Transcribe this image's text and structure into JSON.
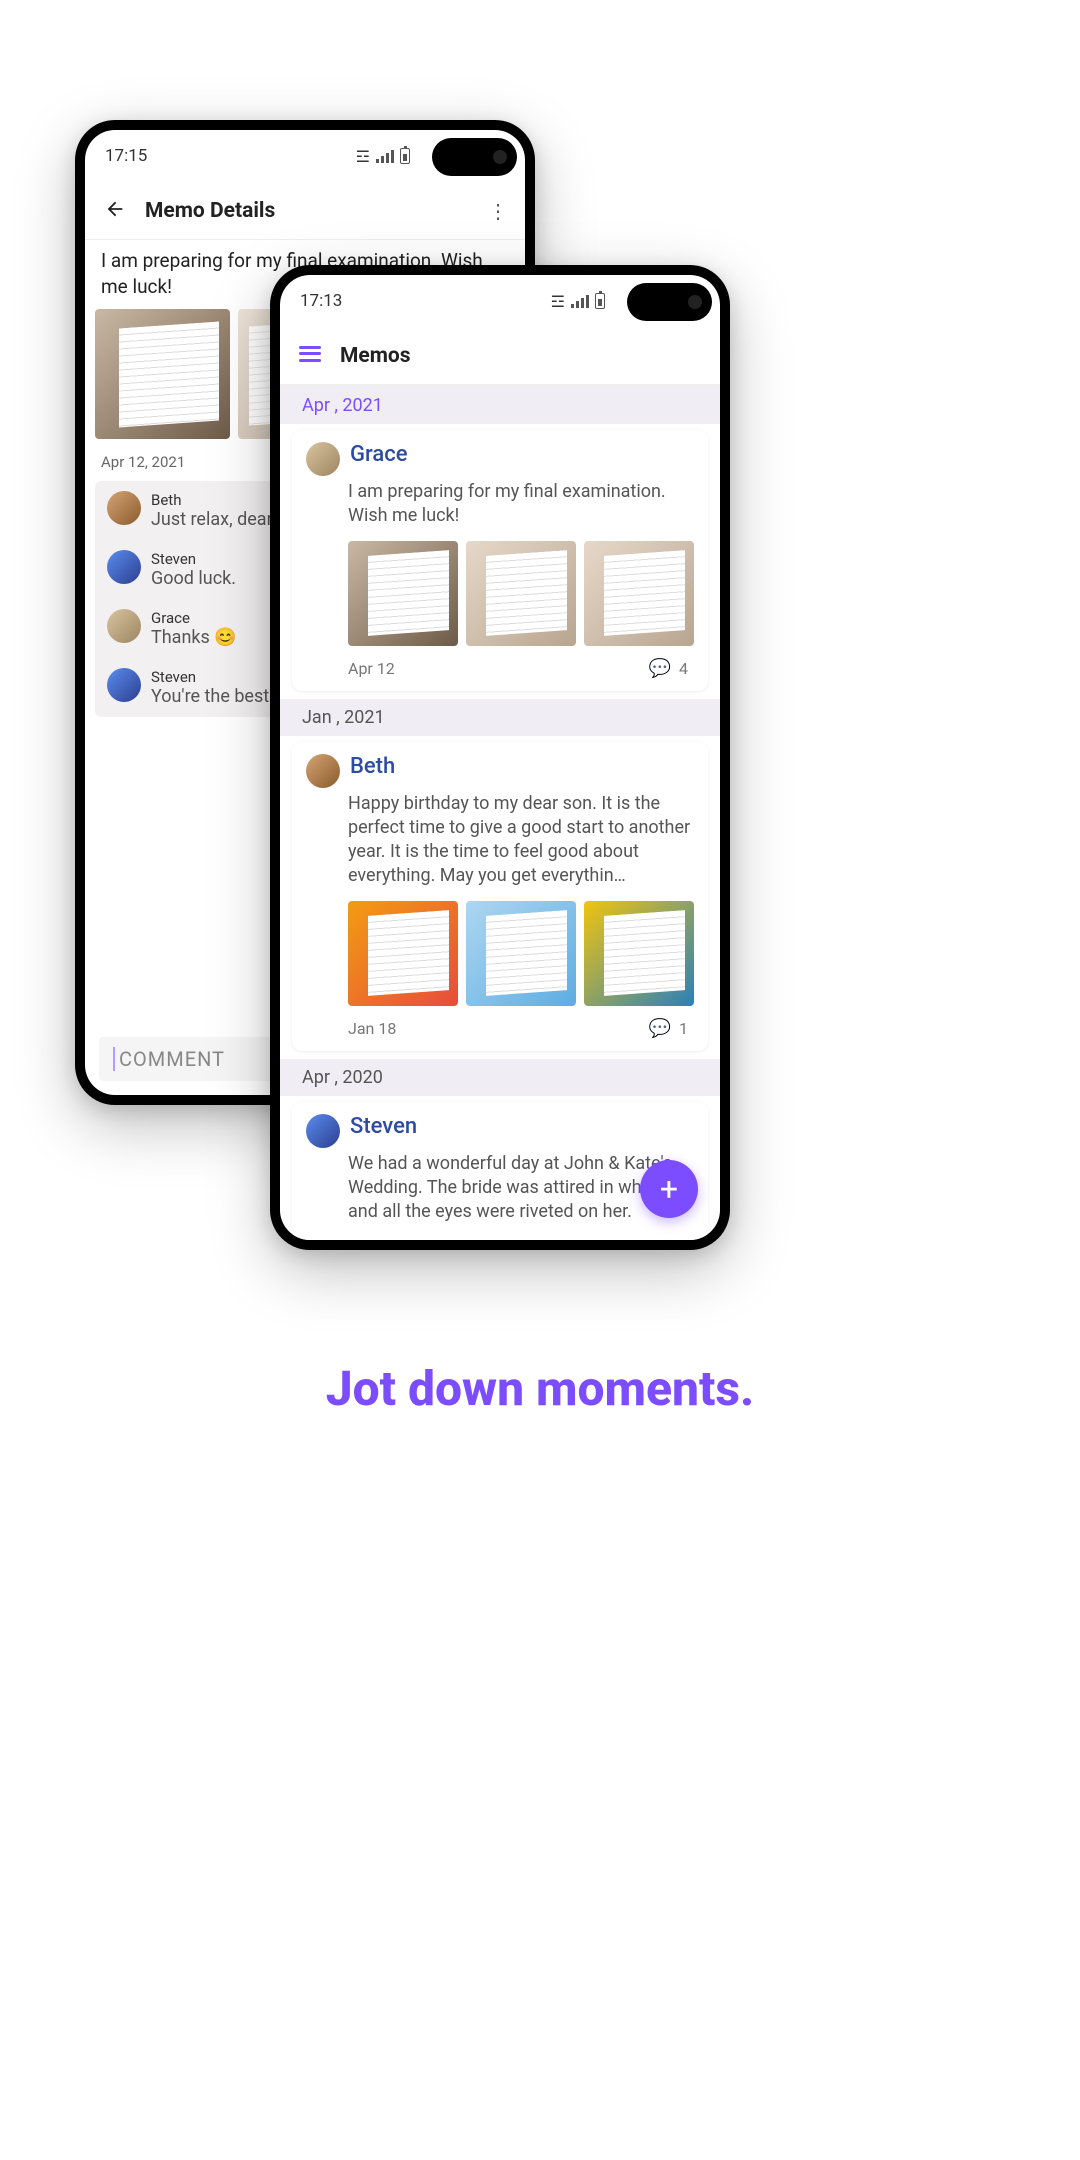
{
  "tagline": "Jot down moments.",
  "back": {
    "status": {
      "time": "17:15"
    },
    "appbar": {
      "title": "Memo Details"
    },
    "memo_text": "I am preparing for my final examination. Wish me luck!",
    "date": "Apr 12, 2021",
    "comments": [
      {
        "name": "Beth",
        "text": "Just relax, dear"
      },
      {
        "name": "Steven",
        "text": "Good luck."
      },
      {
        "name": "Grace",
        "text": "Thanks 😊"
      },
      {
        "name": "Steven",
        "text": "You're the best👍"
      }
    ],
    "comment_placeholder": "COMMENT"
  },
  "front": {
    "status": {
      "time": "17:13"
    },
    "appbar": {
      "title": "Memos"
    },
    "sections": [
      {
        "label": "Apr , 2021",
        "accent": true
      },
      {
        "label": "Jan , 2021",
        "accent": false
      },
      {
        "label": "Apr , 2020",
        "accent": false
      }
    ],
    "memos": [
      {
        "author": "Grace",
        "body": "I am preparing for my final examination. Wish me luck!",
        "date": "Apr 12",
        "comment_count": "4"
      },
      {
        "author": "Beth",
        "body": "Happy birthday to my dear son. It is the perfect time to give a good start to another year. It is the time to feel good about everything. May you get everythin…",
        "date": "Jan 18",
        "comment_count": "1"
      },
      {
        "author": "Steven",
        "body": "We had a wonderful day at John & Kate's Wedding. The bride was attired in white and all the eyes were riveted on her."
      }
    ]
  }
}
